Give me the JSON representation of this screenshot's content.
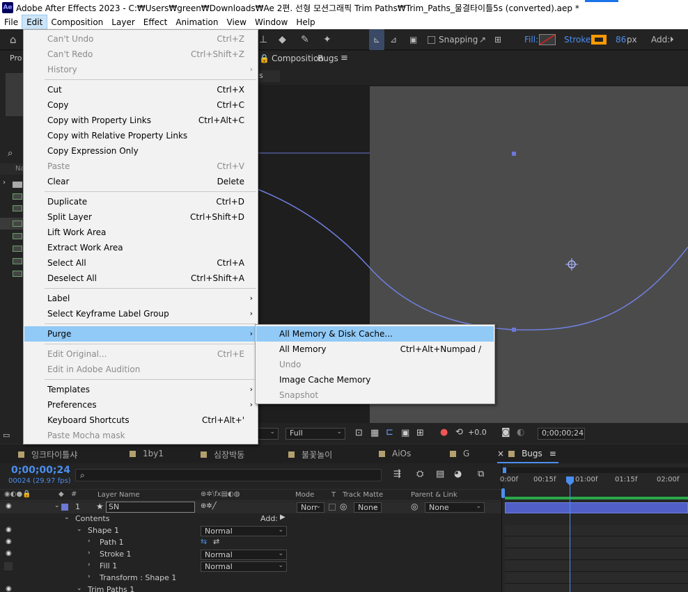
{
  "app": {
    "logo": "Ae",
    "title": "Adobe After Effects 2023 - C:₩Users₩green₩Downloads₩Ae 2편. 선형 모션그래픽 Trim Paths₩Trim_Paths_물결타이틀5s (converted).aep *"
  },
  "menubar": [
    "File",
    "Edit",
    "Composition",
    "Layer",
    "Effect",
    "Animation",
    "View",
    "Window",
    "Help"
  ],
  "toolbar": {
    "snapping": "Snapping",
    "fill": "Fill:",
    "stroke": "Stroke:",
    "stroke_width": "86",
    "stroke_unit": "px",
    "add": "Add:",
    "stroke_color": "#ff9a00"
  },
  "project_panel": {
    "tab": "Pro",
    "search_icon": "⌕",
    "col_name": "Na"
  },
  "composition_panel": {
    "label": "Composition",
    "name": "Bugs",
    "menu": "≡",
    "subtab": "s"
  },
  "viewer_bar": {
    "resolution": "Full",
    "exposure": "+0.0",
    "timecode": "0;00;00;24"
  },
  "edit_menu": {
    "items": [
      {
        "label": "Can't Undo",
        "shortcut": "Ctrl+Z",
        "disabled": true
      },
      {
        "label": "Can't Redo",
        "shortcut": "Ctrl+Shift+Z",
        "disabled": true
      },
      {
        "label": "History",
        "shortcut": "",
        "disabled": true,
        "submenu": true
      },
      {
        "sep": true
      },
      {
        "label": "Cut",
        "shortcut": "Ctrl+X"
      },
      {
        "label": "Copy",
        "shortcut": "Ctrl+C"
      },
      {
        "label": "Copy with Property Links",
        "shortcut": "Ctrl+Alt+C"
      },
      {
        "label": "Copy with Relative Property Links",
        "shortcut": ""
      },
      {
        "label": "Copy Expression Only",
        "shortcut": ""
      },
      {
        "label": "Paste",
        "shortcut": "Ctrl+V",
        "disabled": true
      },
      {
        "label": "Clear",
        "shortcut": "Delete"
      },
      {
        "sep": true
      },
      {
        "label": "Duplicate",
        "shortcut": "Ctrl+D"
      },
      {
        "label": "Split Layer",
        "shortcut": "Ctrl+Shift+D"
      },
      {
        "label": "Lift Work Area",
        "shortcut": ""
      },
      {
        "label": "Extract Work Area",
        "shortcut": ""
      },
      {
        "label": "Select All",
        "shortcut": "Ctrl+A"
      },
      {
        "label": "Deselect All",
        "shortcut": "Ctrl+Shift+A"
      },
      {
        "sep": true
      },
      {
        "label": "Label",
        "shortcut": "",
        "submenu": true
      },
      {
        "label": "Select Keyframe Label Group",
        "shortcut": "",
        "submenu": true
      },
      {
        "sep": true
      },
      {
        "label": "Purge",
        "shortcut": "",
        "submenu": true,
        "highlighted": true
      },
      {
        "sep": true
      },
      {
        "label": "Edit Original...",
        "shortcut": "Ctrl+E",
        "disabled": true
      },
      {
        "label": "Edit in Adobe Audition",
        "shortcut": "",
        "disabled": true
      },
      {
        "sep": true
      },
      {
        "label": "Templates",
        "shortcut": "",
        "submenu": true
      },
      {
        "label": "Preferences",
        "shortcut": "",
        "submenu": true
      },
      {
        "label": "Keyboard Shortcuts",
        "shortcut": "Ctrl+Alt+'"
      },
      {
        "label": "Paste Mocha mask",
        "shortcut": "",
        "disabled": true
      }
    ]
  },
  "purge_menu": {
    "items": [
      {
        "label": "All Memory & Disk Cache...",
        "shortcut": "",
        "highlighted": true
      },
      {
        "label": "All Memory",
        "shortcut": "Ctrl+Alt+Numpad /"
      },
      {
        "label": "Undo",
        "shortcut": "",
        "disabled": true
      },
      {
        "label": "Image Cache Memory",
        "shortcut": ""
      },
      {
        "label": "Snapshot",
        "shortcut": "",
        "disabled": true
      }
    ]
  },
  "timeline": {
    "tabs": [
      {
        "label": "잉크타이틀샤",
        "color": "#b3a06e"
      },
      {
        "label": "1by1",
        "color": "#b3a06e"
      },
      {
        "label": "심장박동",
        "color": "#b3a06e"
      },
      {
        "label": "불꽃놀이",
        "color": "#b3a06e"
      },
      {
        "label": "AiOs",
        "color": "#b3a06e"
      },
      {
        "label": "G",
        "color": "#b3a06e"
      },
      {
        "label": "Bugs",
        "color": "#b3a06e",
        "active": true
      }
    ],
    "close_icon": "×",
    "tab_menu": "≡",
    "current_time": "0;00;00;24",
    "frame_info": "00024 (29.97 fps)",
    "search_icon": "⌕",
    "columns": {
      "layer_name": "Layer Name",
      "mode": "Mode",
      "t": "T",
      "track_matte": "Track Matte",
      "parent": "Parent & Link"
    },
    "ruler": [
      "0:00f",
      "00:15f",
      "01:00f",
      "01:15f",
      "02:00f"
    ],
    "layer": {
      "index": "1",
      "name": "SN",
      "mode": "Norr",
      "matte": "None",
      "parent": "None"
    },
    "rows": [
      {
        "label": "Contents",
        "indent": 1,
        "add": "Add:",
        "add_icon": "▶"
      },
      {
        "label": "Shape 1",
        "indent": 2,
        "mode": "Normal",
        "eye": true
      },
      {
        "label": "Path 1",
        "indent": 3,
        "eye": true
      },
      {
        "label": "Stroke 1",
        "indent": 3,
        "mode": "Normal",
        "eye": true
      },
      {
        "label": "Fill 1",
        "indent": 3,
        "mode": "Normal",
        "eye": true
      },
      {
        "label": "Transform : Shape 1",
        "indent": 3
      },
      {
        "label": "Trim Paths 1",
        "indent": 2,
        "eye": true
      }
    ]
  }
}
